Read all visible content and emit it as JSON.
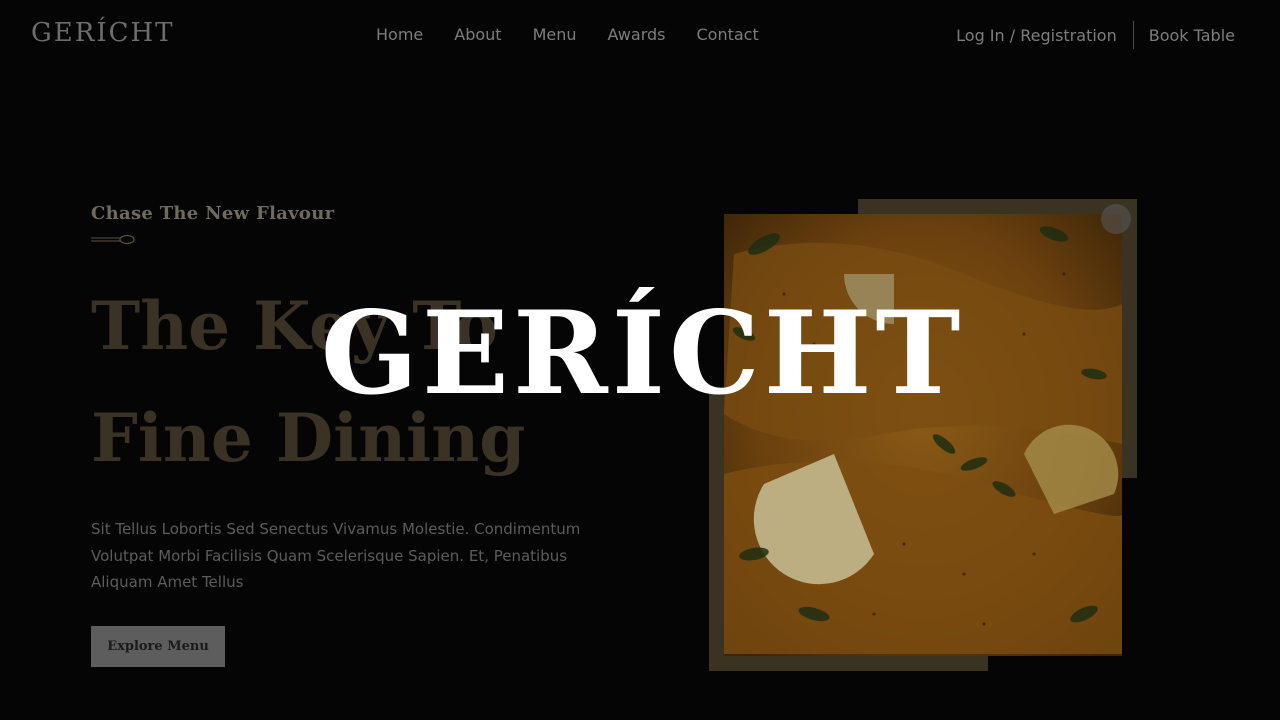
{
  "brand": {
    "logo_text": "GERÍCHT",
    "overlay_logo_text": "GERÍCHT"
  },
  "nav": {
    "links": [
      "Home",
      "About",
      "Menu",
      "Awards",
      "Contact"
    ],
    "login_label": "Log In / Registration",
    "book_label": "Book Table"
  },
  "hero": {
    "subtitle": "Chase The New Flavour",
    "title_line1": "The Key To",
    "title_line2": "Fine Dining",
    "description": "Sit Tellus Lobortis Sed Senectus Vivamus Molestie. Condimentum Volutpat Morbi Facilisis Quam Scelerisque Sapien. Et, Penatibus Aliquam Amet Tellus",
    "cta_label": "Explore Menu",
    "image_icon": "camera-icon",
    "spoon_icon": "spoon-icon"
  },
  "colors": {
    "background": "#050505",
    "accent_gold": "#3a3322",
    "title_gold": "#3a3325",
    "overlay_text": "#ffffff",
    "button_bg": "#5d5d5d"
  }
}
